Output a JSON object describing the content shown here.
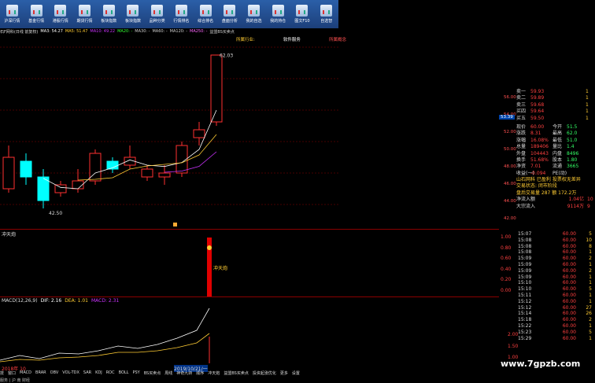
{
  "toolbar": {
    "items": [
      {
        "label": "沪深行情",
        "icon": "quote-icon"
      },
      {
        "label": "基金行情",
        "icon": "fund-icon"
      },
      {
        "label": "港股行情",
        "icon": "hk-icon"
      },
      {
        "label": "期货行情",
        "icon": "futures-icon"
      },
      {
        "label": "板块指数",
        "icon": "sector-index-icon"
      },
      {
        "label": "板块指数",
        "icon": "sector-index-icon"
      },
      {
        "label": "品种分类",
        "icon": "category-icon"
      },
      {
        "label": "行情排名",
        "icon": "ranking-icon"
      },
      {
        "label": "综合排名",
        "icon": "composite-ranking-icon"
      },
      {
        "label": "盘面分析",
        "icon": "analysis-icon"
      },
      {
        "label": "我的自选",
        "icon": "watchlist-icon"
      },
      {
        "label": "我的持仓",
        "icon": "holdings-icon"
      },
      {
        "label": "图文F10",
        "icon": "f10-icon"
      },
      {
        "label": "自选智",
        "icon": "smart-icon"
      }
    ]
  },
  "chart_info": {
    "stock": "石F网科(日线 前复权)",
    "ma3": "MA3: 54.27",
    "ma5": "MA5: 51.47",
    "ma10": "MA10: 49.22",
    "ma20": "MA20: -",
    "ma30": "MA30: -",
    "ma60": "MA60: -",
    "ma120": "MA120: -",
    "ma250": "MA250: -",
    "extra": "益盟BS买卖点"
  },
  "links": {
    "a": "所属行业:",
    "b": "软件服务",
    "c": "所属概念"
  },
  "colors": {
    "up": "#ff3030",
    "down": "#00ffff",
    "ma1": "#ffffff",
    "ma2": "#ffcc33",
    "ma3": "#cc33ff",
    "grid": "#8b0000"
  },
  "panels": {
    "main": {
      "ylabels": [
        "50.00",
        "48.00",
        "46.00",
        "44.00",
        "42.00"
      ],
      "high_label": "62.03",
      "low_label": "42.50",
      "price_box": "53.39"
    },
    "indicator": {
      "label": "冲天炮",
      "ylabels": [
        "1.00",
        "0.80",
        "0.60",
        "0.40",
        "0.20",
        "0.00"
      ],
      "value_label": "冲天炮"
    },
    "macd": {
      "label": "MACD(12,26,9)",
      "dif": "DIF: 2.16",
      "dea": "DEA: 1.01",
      "macd": "MACD: 2.31",
      "ylabels": [
        "2.00",
        "1.50",
        "1.00"
      ],
      "date_left": "2018年 10",
      "date_right": "2019/10/21/一"
    }
  },
  "chart_data": {
    "type": "candlestick",
    "candles": [
      {
        "open": 45.0,
        "close": 49.0,
        "high": 50.5,
        "low": 44.5
      },
      {
        "open": 48.5,
        "close": 46.5,
        "high": 49.5,
        "low": 45.5
      },
      {
        "open": 46.5,
        "close": 43.5,
        "high": 47.5,
        "low": 42.5
      },
      {
        "open": 44.5,
        "close": 45.5,
        "high": 46.0,
        "low": 44.0
      },
      {
        "open": 45.0,
        "close": 46.0,
        "high": 47.5,
        "low": 44.5
      },
      {
        "open": 46.0,
        "close": 49.5,
        "high": 50.0,
        "low": 45.5
      },
      {
        "open": 48.5,
        "close": 47.5,
        "high": 49.0,
        "low": 47.0
      },
      {
        "open": 48.0,
        "close": 49.0,
        "high": 50.5,
        "low": 47.5
      },
      {
        "open": 46.5,
        "close": 47.5,
        "high": 48.0,
        "low": 46.0
      },
      {
        "open": 46.5,
        "close": 47.0,
        "high": 48.0,
        "low": 45.5
      },
      {
        "open": 47.0,
        "close": 50.5,
        "high": 51.0,
        "low": 46.5
      },
      {
        "open": 51.5,
        "close": 52.5,
        "high": 53.5,
        "low": 50.5
      },
      {
        "open": 53.5,
        "close": 62.0,
        "high": 62.03,
        "low": 53.0
      }
    ],
    "ylim": [
      41,
      63
    ]
  },
  "right_panel": {
    "sell_book": [
      {
        "label": "卖一",
        "price": "59.93",
        "vol": "1"
      },
      {
        "label": "卖二",
        "price": "59.89",
        "vol": "1"
      },
      {
        "label": "卖三",
        "price": "59.68",
        "vol": "1"
      },
      {
        "label": "买四",
        "price": "59.64",
        "vol": "1"
      },
      {
        "label": "买五",
        "price": "59.50",
        "vol": "1"
      }
    ],
    "scale_labels": [
      "56.00",
      "54.00",
      "52.00",
      "50.00",
      "48.00",
      "46.00",
      "44.00",
      "42.00"
    ],
    "stats": [
      {
        "k1": "现价",
        "v1": "60.00",
        "k2": "今开",
        "v2": "51.5"
      },
      {
        "k1": "涨跌",
        "v1": "8.31",
        "k2": "最高",
        "v2": "62.0"
      },
      {
        "k1": "涨幅",
        "v1": "16.08%",
        "k2": "最低",
        "v2": "51.0"
      },
      {
        "k1": "总量",
        "v1": "189406",
        "k2": "量比",
        "v2": "1.4"
      },
      {
        "k1": "外盘",
        "v1": "104443",
        "k2": "内盘",
        "v2": "8496"
      },
      {
        "k1": "换手",
        "v1": "51.68%",
        "k2": "股本",
        "v2": "1.80"
      },
      {
        "k1": "净资",
        "v1": "7.01",
        "k2": "流通",
        "v2": "3665"
      },
      {
        "k1": "收益(一)",
        "v1": "-0.094",
        "k2": "PE(动)",
        "v2": ""
      }
    ],
    "notes": [
      "山石网科 已盈利 投票权无差异",
      "交易状态: 闭市阶段",
      "盘后交易量 287 额 172.2万"
    ],
    "flows": [
      {
        "k": "净流入额",
        "v": "1.04亿",
        "v2": "10"
      },
      {
        "k": "大宗流入",
        "v": "9114万",
        "v2": "9"
      }
    ],
    "ticks": [
      {
        "time": "15:07",
        "price": "60.00",
        "vol": "5"
      },
      {
        "time": "15:08",
        "price": "60.00",
        "vol": "10"
      },
      {
        "time": "15:08",
        "price": "60.00",
        "vol": "8"
      },
      {
        "time": "15:08",
        "price": "60.00",
        "vol": "1"
      },
      {
        "time": "15:09",
        "price": "60.00",
        "vol": "2"
      },
      {
        "time": "15:09",
        "price": "60.00",
        "vol": "1"
      },
      {
        "time": "15:09",
        "price": "60.00",
        "vol": "2"
      },
      {
        "time": "15:09",
        "price": "60.00",
        "vol": "1"
      },
      {
        "time": "15:10",
        "price": "60.00",
        "vol": "1"
      },
      {
        "time": "15:10",
        "price": "60.00",
        "vol": "5"
      },
      {
        "time": "15:11",
        "price": "60.00",
        "vol": "1"
      },
      {
        "time": "15:12",
        "price": "60.00",
        "vol": "1"
      },
      {
        "time": "15:12",
        "price": "60.00",
        "vol": "27"
      },
      {
        "time": "15:14",
        "price": "60.00",
        "vol": "26"
      },
      {
        "time": "15:18",
        "price": "60.00",
        "vol": "2"
      },
      {
        "time": "15:22",
        "price": "60.00",
        "vol": "1"
      },
      {
        "time": "15:23",
        "price": "60.00",
        "vol": "5"
      },
      {
        "time": "15:29",
        "price": "60.00",
        "vol": "1"
      }
    ]
  },
  "indicator_tabs": [
    "技",
    "窗口",
    "MACD",
    "BRAR",
    "OBV",
    "VOL-TDX",
    "SAR",
    "KDJ",
    "ROC",
    "BOLL",
    "PSY",
    "BS买卖点",
    "周线",
    "神奇九转",
    "顺序",
    "冲天炮",
    "益盟BS买卖点",
    "投资起涨优化",
    "更多",
    "设置"
  ],
  "watermark": "www.7gpzb.com",
  "status": "服务 | 沪  南  财经"
}
